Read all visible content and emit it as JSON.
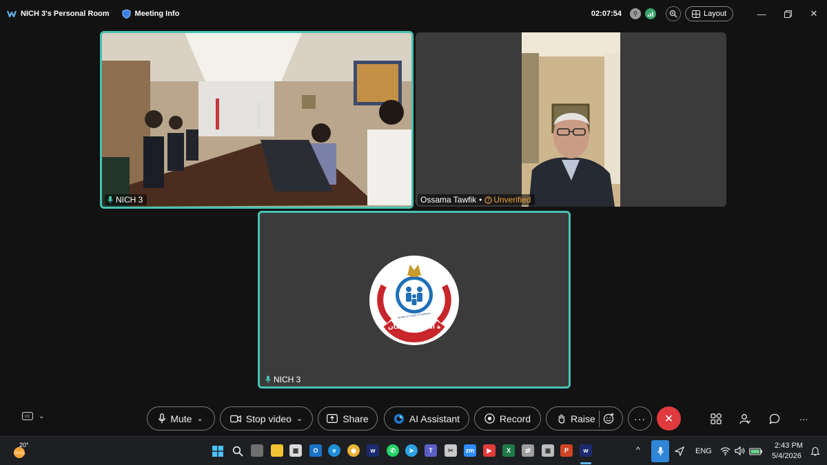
{
  "titlebar": {
    "room_title": "NICH 3's Personal Room",
    "meeting_info": "Meeting Info",
    "timer": "02:07:54",
    "layout_label": "Layout"
  },
  "tiles": [
    {
      "name": "NICH 3"
    },
    {
      "name": "Ossama Tawfik",
      "badge": "Unverified"
    },
    {
      "name": "NICH 3",
      "logo_text_en": "Ministry of Health & Population",
      "logo_text_ar": "وزارة الصحة والسكان"
    }
  ],
  "controls": {
    "mute": "Mute",
    "stop_video": "Stop video",
    "share": "Share",
    "ai_assistant": "AI Assistant",
    "record": "Record",
    "raise": "Raise"
  },
  "taskbar": {
    "temperature": "20°",
    "language": "ENG",
    "time": "2:43 PM",
    "date": "5/4/2026"
  },
  "colors": {
    "accent": "#47c3b2",
    "end_call": "#e03a3e",
    "unverified": "#f0a23a",
    "mic_active": "#2f86d6"
  }
}
